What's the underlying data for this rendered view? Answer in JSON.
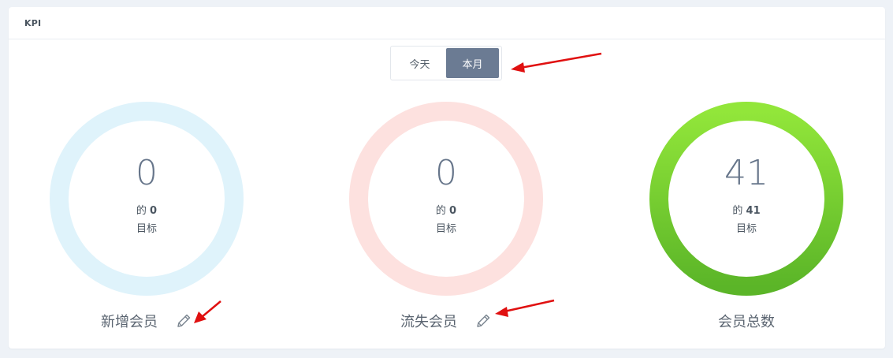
{
  "card": {
    "title": "KPI"
  },
  "toggle": {
    "today_label": "今天",
    "month_label": "本月",
    "selected": "本月"
  },
  "kpis": [
    {
      "value": "0",
      "of_prefix": "的",
      "target": "0",
      "goal_label": "目标",
      "name": "新增会员",
      "ring_color": "#dff3fb",
      "editable": true
    },
    {
      "value": "0",
      "of_prefix": "的",
      "target": "0",
      "goal_label": "目标",
      "name": "流失会员",
      "ring_color": "#fde1df",
      "editable": true
    },
    {
      "value": "41",
      "of_prefix": "的",
      "target": "41",
      "goal_label": "目标",
      "name": "会员总数",
      "ring_color_top": "#8ee43a",
      "ring_color_bottom": "#5cb82a",
      "editable": false
    }
  ],
  "colors": {
    "accent_toggle": "#6b7b93",
    "annotation_arrow": "#e01010"
  }
}
